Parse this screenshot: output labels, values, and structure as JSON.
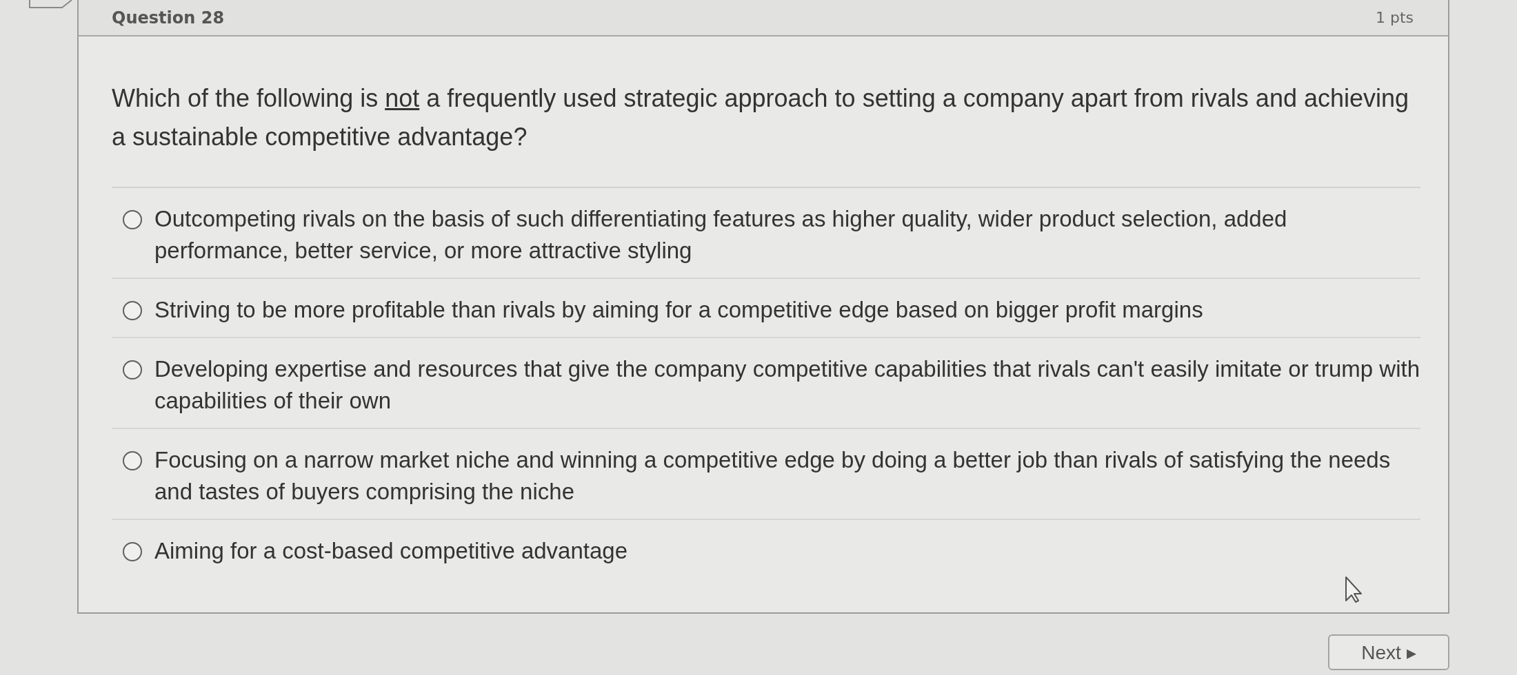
{
  "header": {
    "title": "Question 28",
    "points": "1 pts"
  },
  "question": {
    "segments": [
      {
        "text": "Which of the following is ",
        "underline": false
      },
      {
        "text": "not",
        "underline": true
      },
      {
        "text": " a frequently used strategic approach to setting a company apart from rivals and achieving a sustainable competitive advantage?",
        "underline": false
      }
    ]
  },
  "answers": [
    {
      "text": "Outcompeting rivals on the basis of such differentiating features as higher quality, wider product selection, added performance, better service, or more attractive styling",
      "selected": false
    },
    {
      "text": "Striving to be more profitable than rivals by aiming for a competitive edge based on bigger profit margins",
      "selected": false
    },
    {
      "text": "Developing expertise and resources that give the company competitive capabilities that rivals can't easily imitate or trump with capabilities of their own",
      "selected": false
    },
    {
      "text": "Focusing on a narrow market niche and winning a competitive edge by doing a better job than rivals of satisfying the needs and tastes of buyers comprising the niche",
      "selected": false
    },
    {
      "text": "Aiming for a cost-based competitive advantage",
      "selected": false
    }
  ],
  "next_button": {
    "label": "Next",
    "icon": "▸"
  }
}
